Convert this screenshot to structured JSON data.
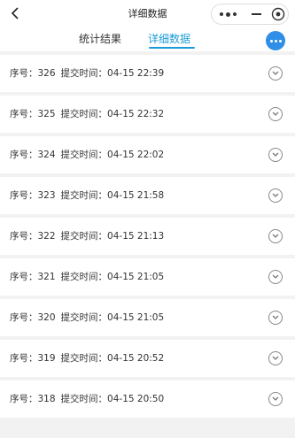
{
  "nav": {
    "title": "详细数据"
  },
  "tabs": [
    {
      "label": "统计结果",
      "active": false
    },
    {
      "label": "详细数据",
      "active": true
    }
  ],
  "colors": {
    "accent": "#1c9bd8",
    "fab": "#2f8fe6"
  },
  "rows": [
    {
      "seq_label": "序号：",
      "seq": "326",
      "time_label": "提交时间：",
      "time": "04-15 22:39"
    },
    {
      "seq_label": "序号：",
      "seq": "325",
      "time_label": "提交时间：",
      "time": "04-15 22:32"
    },
    {
      "seq_label": "序号：",
      "seq": "324",
      "time_label": "提交时间：",
      "time": "04-15 22:02"
    },
    {
      "seq_label": "序号：",
      "seq": "323",
      "time_label": "提交时间：",
      "time": "04-15 21:58"
    },
    {
      "seq_label": "序号：",
      "seq": "322",
      "time_label": "提交时间：",
      "time": "04-15 21:13"
    },
    {
      "seq_label": "序号：",
      "seq": "321",
      "time_label": "提交时间：",
      "time": "04-15 21:05"
    },
    {
      "seq_label": "序号：",
      "seq": "320",
      "time_label": "提交时间：",
      "time": "04-15 21:05"
    },
    {
      "seq_label": "序号：",
      "seq": "319",
      "time_label": "提交时间：",
      "time": "04-15 20:52"
    },
    {
      "seq_label": "序号：",
      "seq": "318",
      "time_label": "提交时间：",
      "time": "04-15 20:50"
    }
  ],
  "icons": {
    "back": "chevron-left-icon",
    "more": "more-dots-icon",
    "minimize": "minimize-icon",
    "close": "close-circle-icon",
    "fab": "more-dots-icon",
    "expand": "chevron-down-circle-icon"
  }
}
